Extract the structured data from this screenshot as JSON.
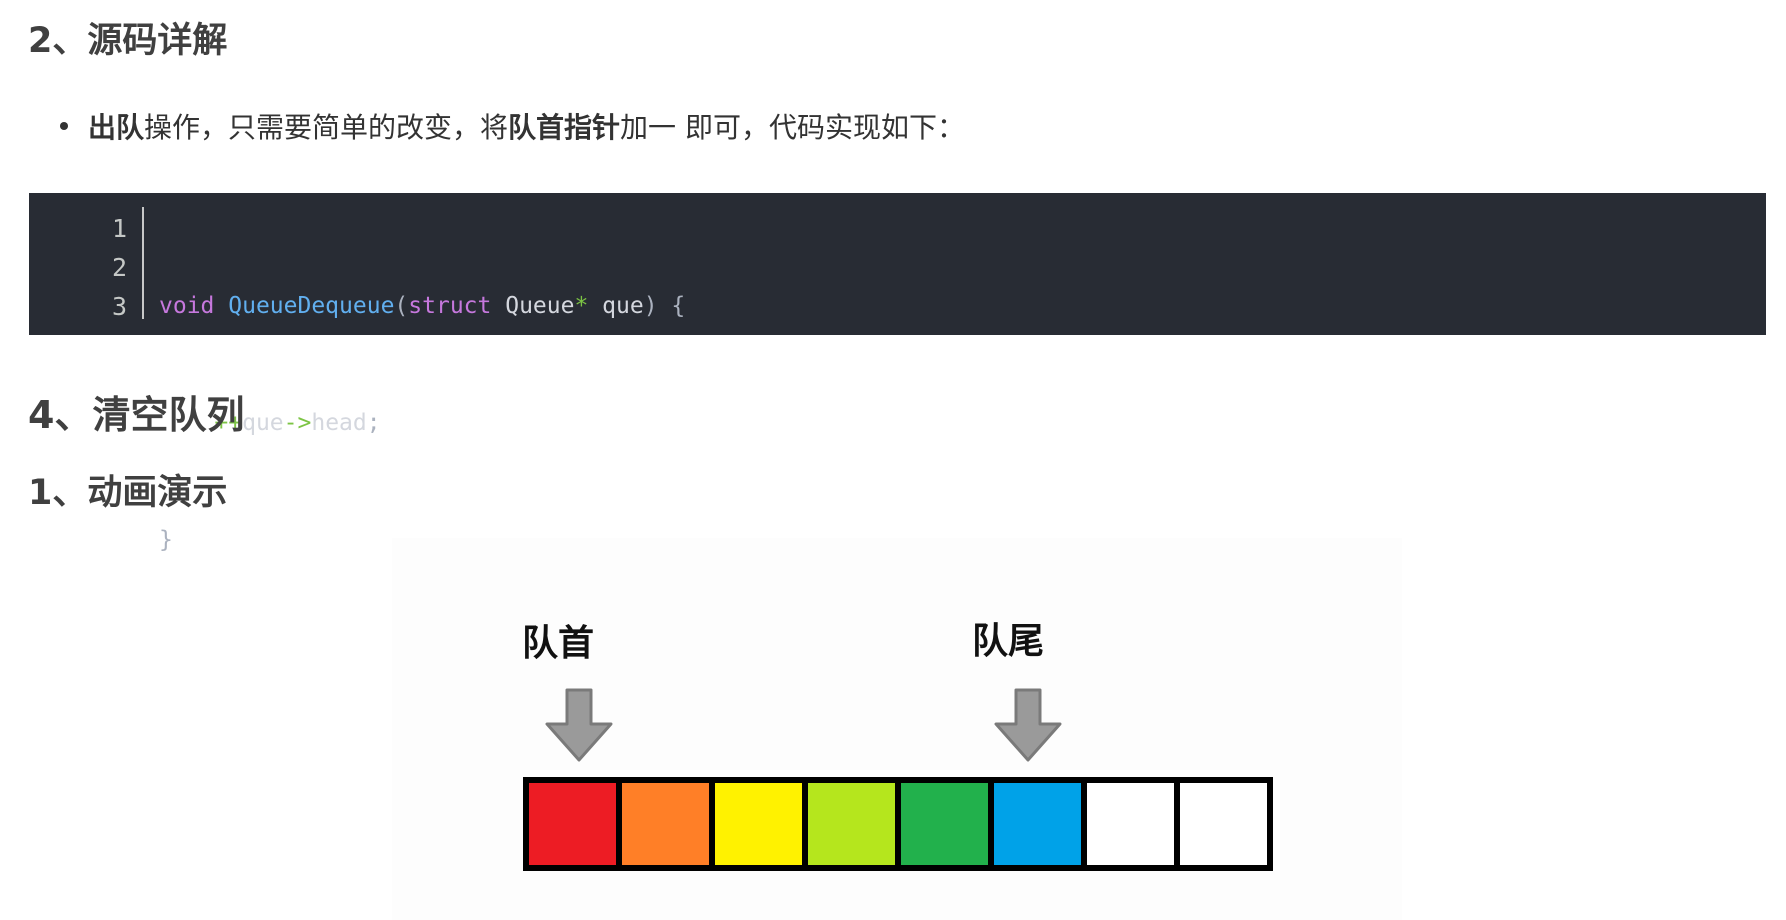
{
  "headings": {
    "source_detail": "2、源码详解",
    "clear_queue": "4、清空队列",
    "animation": "1、动画演示"
  },
  "bullet": {
    "part1": "出队",
    "part2": " 操作，只需要简单的改变，将 ",
    "part3": "队首指针",
    "part4": " 加一 即可，代码实现如下："
  },
  "code": {
    "line_numbers": [
      "1",
      "2",
      "3"
    ],
    "line1": {
      "kw1": "void",
      "fn": "QueueDequeue",
      "p1": "(",
      "kw2": "struct",
      "t1": " Queue",
      "op1": "*",
      "t2": " que",
      "p2": ") {"
    },
    "line2": {
      "indent": "    ",
      "op1": "++",
      "t1": "que",
      "op2": "->",
      "t2": "head",
      "p1": ";"
    },
    "line3": {
      "p1": "}"
    }
  },
  "animation": {
    "head_label": "队首",
    "tail_label": "队尾",
    "cells": [
      "#ed1c24",
      "#ff7f27",
      "#fff200",
      "#b5e61d",
      "#22b14c",
      "#00a2e8",
      "#ffffff",
      "#ffffff"
    ],
    "arrow_color": "#9a9a9a"
  }
}
